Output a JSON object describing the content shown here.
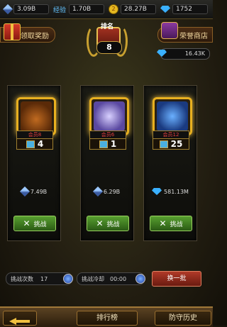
{
  "topbar": {
    "power_value": "3.09B",
    "exp_label": "经验",
    "exp_value": "1.70B",
    "gold_value": "28.27B",
    "gems_value": "1752"
  },
  "header": {
    "claim_reward_label": "领取奖励",
    "rank_title": "排名",
    "rank_value": "8",
    "shop_label": "荣誉商店",
    "honor_value": "16.43K"
  },
  "opponents": [
    {
      "level_label": "会员8",
      "count": "4",
      "power": "7.49B",
      "stat_icon": "sword-icon",
      "challenge_label": "挑战",
      "art_color": "#8a3a10"
    },
    {
      "level_label": "会员6",
      "count": "1",
      "power": "6.29B",
      "stat_icon": "sword-icon",
      "challenge_label": "挑战",
      "art_color": "#6a58b0"
    },
    {
      "level_label": "会员12",
      "count": "25",
      "power": "581.13M",
      "stat_icon": "gem-icon",
      "challenge_label": "挑战",
      "art_color": "#2a5aa0"
    }
  ],
  "bottom": {
    "attempts_label": "挑战次数",
    "attempts_value": "17",
    "cooldown_label": "挑战冷却",
    "cooldown_value": "00:00",
    "refresh_label": "换一批"
  },
  "footer": {
    "leaderboard_label": "排行榜",
    "defense_history_label": "防守历史"
  }
}
